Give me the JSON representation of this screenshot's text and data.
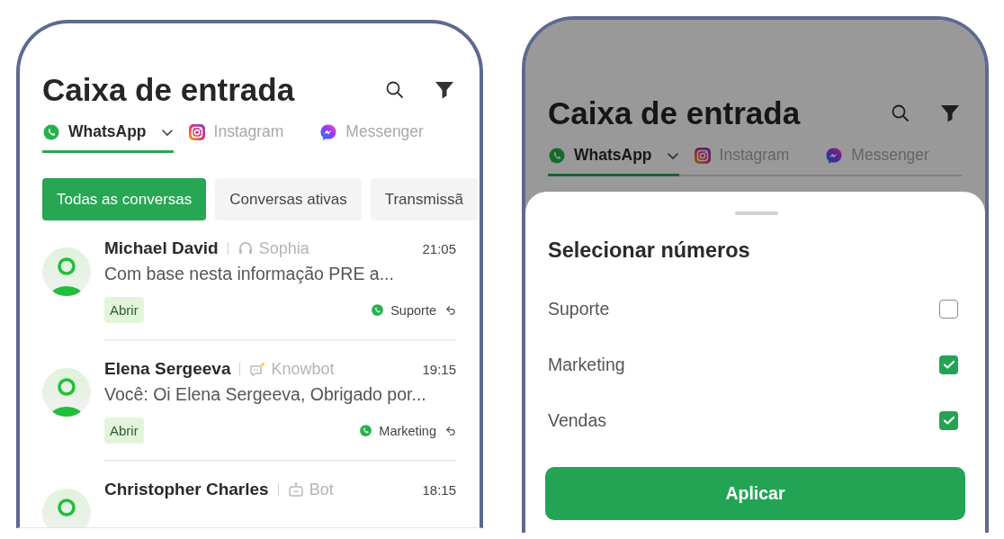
{
  "inbox_screen": {
    "title": "Caixa de entrada",
    "tabs": [
      {
        "label": "WhatsApp",
        "kind": "whatsapp",
        "selected": true,
        "dropdown": true
      },
      {
        "label": "Instagram",
        "kind": "instagram",
        "selected": false,
        "dropdown": false
      },
      {
        "label": "Messenger",
        "kind": "messenger",
        "selected": false,
        "dropdown": false
      }
    ],
    "filters": [
      {
        "label": "Todas as conversas",
        "selected": true
      },
      {
        "label": "Conversas ativas",
        "selected": false
      },
      {
        "label": "Transmissã",
        "selected": false
      }
    ],
    "conversations": [
      {
        "name": "Michael David",
        "kind": "headset",
        "agent": "Sophia",
        "time": "21:05",
        "preview": "Com base nesta informação PRE a...",
        "action": "Abrir",
        "channel": "Suporte"
      },
      {
        "name": "Elena Sergeeva",
        "kind": "knowbot",
        "agent": "Knowbot",
        "time": "19:15",
        "preview": "Você: Oi Elena Sergeeva, Obrigado por...",
        "action": "Abrir",
        "channel": "Marketing"
      },
      {
        "name": "Christopher Charles",
        "kind": "bot",
        "agent": "Bot",
        "time": "18:15"
      }
    ]
  },
  "filter_screen": {
    "title": "Caixa de entrada",
    "tabs": [
      {
        "label": "WhatsApp",
        "kind": "whatsapp",
        "selected": true,
        "dropdown": true
      },
      {
        "label": "Instagram",
        "kind": "instagram",
        "selected": false,
        "dropdown": false
      },
      {
        "label": "Messenger",
        "kind": "messenger",
        "selected": false,
        "dropdown": false
      }
    ],
    "sheet": {
      "title": "Selecionar números",
      "options": [
        {
          "label": "Suporte",
          "checked": false
        },
        {
          "label": "Marketing",
          "checked": true
        },
        {
          "label": "Vendas",
          "checked": true
        }
      ],
      "button": "Aplicar"
    }
  }
}
